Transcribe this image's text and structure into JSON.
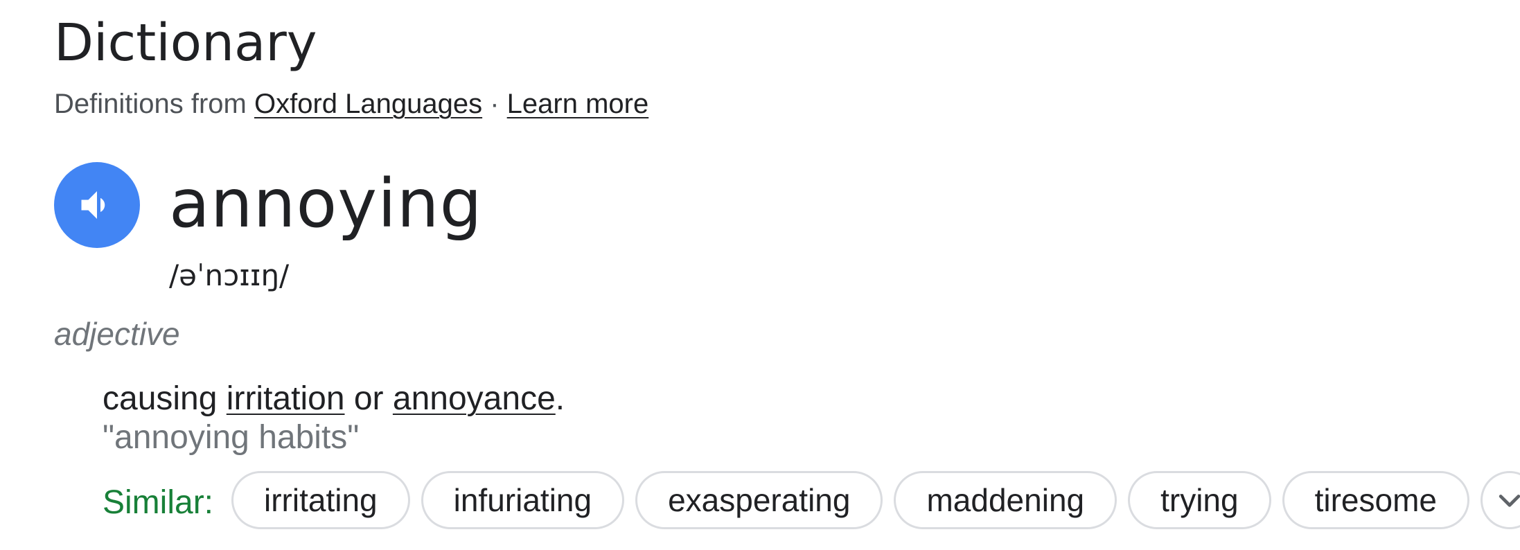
{
  "header": {
    "title": "Dictionary",
    "source_prefix": "Definitions from",
    "source_link": "Oxford Languages",
    "separator": " · ",
    "learn_more": "Learn more"
  },
  "entry": {
    "speaker_icon": "speaker-icon",
    "word": "annoying",
    "phonetic": "/əˈnɔɪɪŋ/",
    "part_of_speech": "adjective",
    "definition": {
      "prefix": "causing",
      "link1": "irritation",
      "middle": "or",
      "link2": "annoyance",
      "suffix": "."
    },
    "example": "\"annoying habits\"",
    "similar_label": "Similar:",
    "similar": [
      "irritating",
      "infuriating",
      "exasperating",
      "maddening",
      "trying",
      "tiresome"
    ],
    "expand_icon": "chevron-down-icon"
  },
  "colors": {
    "speaker_bg": "#4285f4",
    "similar_label": "#188038",
    "muted_text": "#70757a"
  }
}
